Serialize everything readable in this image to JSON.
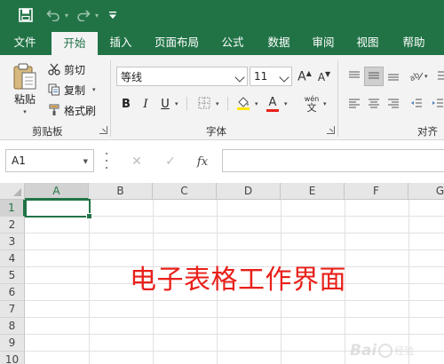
{
  "qat": {
    "save_icon": "save-icon",
    "undo_icon": "undo-icon",
    "redo_icon": "redo-icon",
    "customize_icon": "chevron-down-icon"
  },
  "tabs": [
    {
      "label": "文件",
      "active": false
    },
    {
      "label": "开始",
      "active": true
    },
    {
      "label": "插入",
      "active": false
    },
    {
      "label": "页面布局",
      "active": false
    },
    {
      "label": "公式",
      "active": false
    },
    {
      "label": "数据",
      "active": false
    },
    {
      "label": "审阅",
      "active": false
    },
    {
      "label": "视图",
      "active": false
    },
    {
      "label": "帮助",
      "active": false
    }
  ],
  "ribbon": {
    "clipboard": {
      "paste_label": "粘贴",
      "cut_label": "剪切",
      "copy_label": "复制",
      "format_painter_label": "格式刷",
      "group_label": "剪贴板"
    },
    "font": {
      "font_name": "等线",
      "font_size": "11",
      "group_label": "字体",
      "bold": "B",
      "italic": "I",
      "underline": "U",
      "grow": "A",
      "shrink": "A",
      "font_color_glyph": "A",
      "phonetic_glyph": "wén",
      "phonetic_char": "文"
    },
    "alignment": {
      "group_label": "对齐方"
    }
  },
  "formula_bar": {
    "name_box": "A1",
    "cancel_glyph": "✕",
    "enter_glyph": "✓",
    "fx_glyph": "fx",
    "value": ""
  },
  "grid": {
    "columns": [
      "A",
      "B",
      "C",
      "D",
      "E",
      "F",
      "G"
    ],
    "rows": [
      "1",
      "2",
      "3",
      "4",
      "5",
      "6",
      "7",
      "8",
      "9",
      "10"
    ],
    "selected_cell": "A1"
  },
  "annotation": "电子表格工作界面",
  "watermark": {
    "text": "Bai",
    "cn": "经验"
  },
  "colors": {
    "excel_green": "#217346",
    "ribbon_bg": "#f3f3f3",
    "annotation_red": "#e8201a"
  }
}
